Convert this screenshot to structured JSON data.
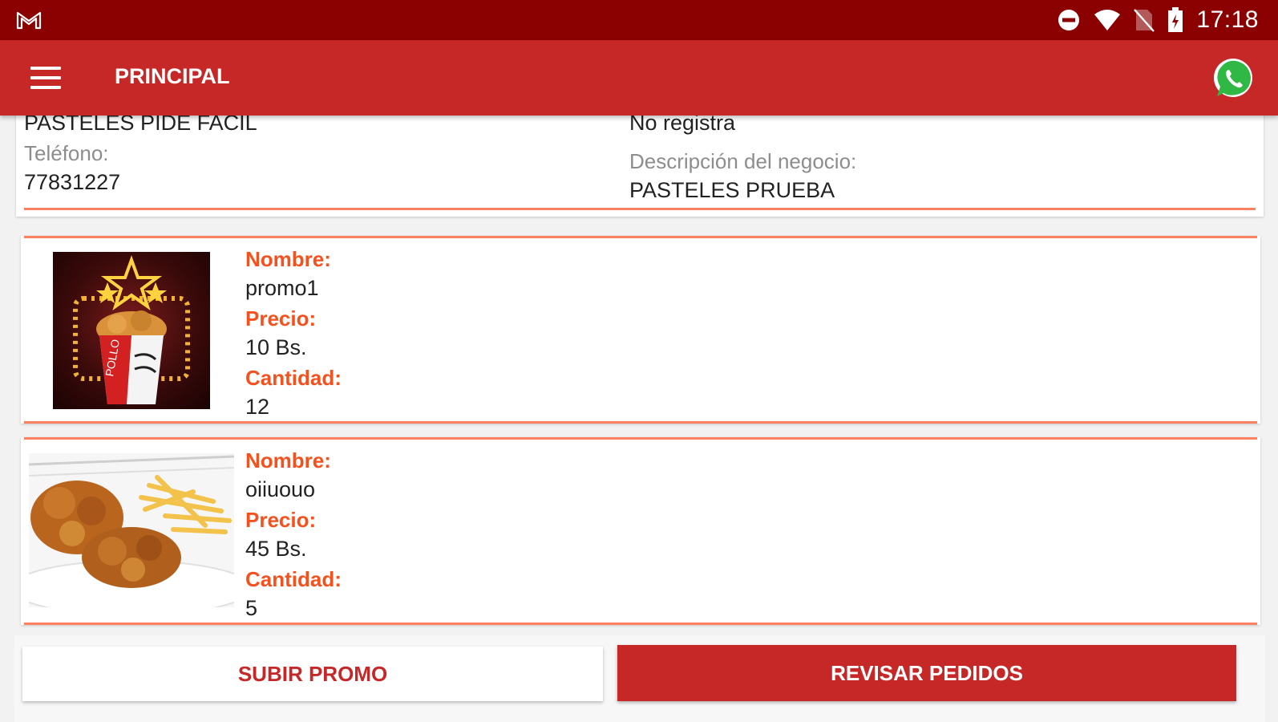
{
  "status_bar": {
    "time": "17:18",
    "icons": [
      "gmail-icon",
      "do-not-disturb-icon",
      "wifi-icon",
      "no-sim-icon",
      "battery-icon"
    ]
  },
  "app_bar": {
    "title": "PRINCIPAL",
    "menu_icon": "hamburger-menu-icon",
    "action_icon": "whatsapp-icon"
  },
  "business": {
    "name": "PASTELES PIDE FACIL",
    "right_top_value": "No registra",
    "phone_label": "Teléfono:",
    "phone": "77831227",
    "description_label": "Descripción del negocio:",
    "description": "PASTELES PRUEBA"
  },
  "promos": [
    {
      "name_label": "Nombre:",
      "name": "promo1",
      "price_label": "Precio:",
      "price": "10 Bs.",
      "qty_label": "Cantidad:",
      "qty": "12"
    },
    {
      "name_label": "Nombre:",
      "name": "oiiuouo",
      "price_label": "Precio:",
      "price": "45 Bs.",
      "qty_label": "Cantidad:",
      "qty": "5"
    }
  ],
  "actions": {
    "upload_label": "SUBIR PROMO",
    "review_label": "REVISAR PEDIDOS"
  },
  "colors": {
    "status_bar": "#8b0000",
    "app_bar": "#c62828",
    "accent_line": "#ff7f61",
    "label_orange": "#f4511e"
  }
}
